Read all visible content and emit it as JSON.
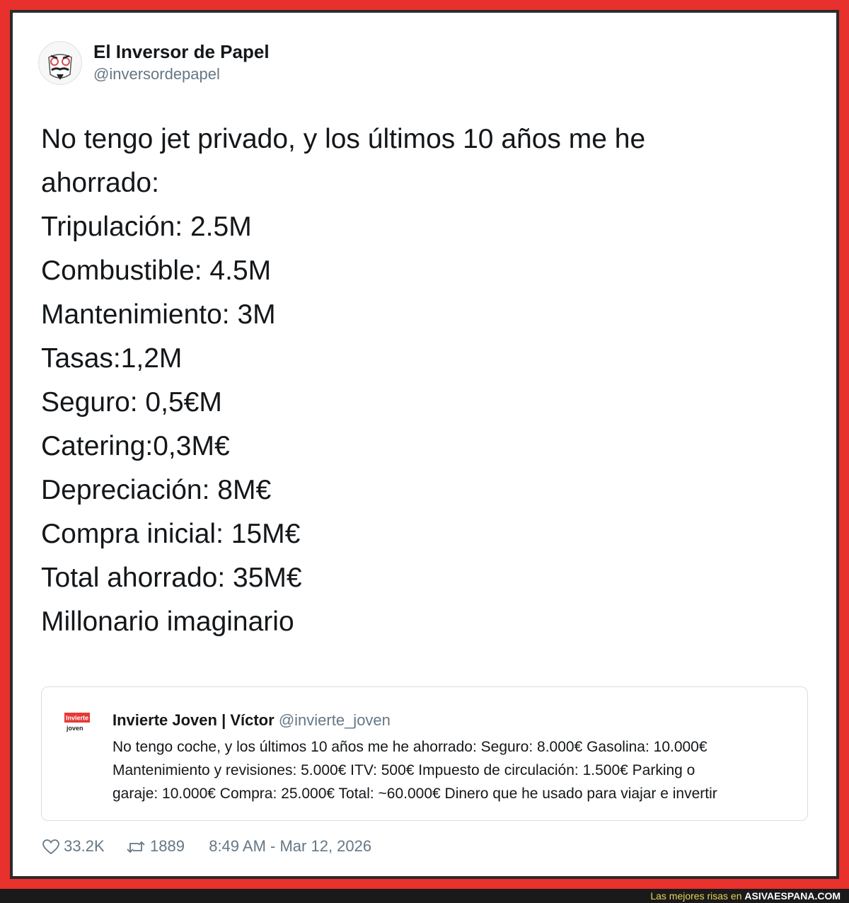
{
  "tweet": {
    "author": {
      "name": "El Inversor de Papel",
      "handle": "@inversordepapel",
      "avatar_icon": "money-heist-mask-icon"
    },
    "lines": [
      "No tengo jet privado, y los últimos 10 años me he",
      "ahorrado:",
      "Tripulación: 2.5M",
      "Combustible: 4.5M",
      "Mantenimiento: 3M",
      "Tasas:1,2M",
      "Seguro: 0,5€M",
      "Catering:0,3M€",
      "Depreciación: 8M€",
      "Compra inicial: 15M€",
      "Total ahorrado: 35M€",
      "Millonario imaginario"
    ],
    "quote": {
      "name": "Invierte Joven | Víctor",
      "handle": "@invierte_joven",
      "logo_line1": "Invierte",
      "logo_line2": "joven",
      "text_lines": [
        "No tengo coche, y los últimos 10 años me he ahorrado: Seguro: 8.000€ Gasolina: 10.000€",
        "Mantenimiento y revisiones: 5.000€ ITV: 500€ Impuesto de circulación: 1.500€ Parking o",
        "garaje: 10.000€ Compra: 25.000€ Total: ~60.000€ Dinero que he usado para viajar e invertir"
      ]
    },
    "footer": {
      "likes": "33.2K",
      "retweets": "1889",
      "timestamp": "8:49 AM - Mar 12, 2026"
    }
  },
  "watermark": {
    "text": "Las mejores risas en",
    "site": "ASIVAESPANA.COM"
  },
  "colors": {
    "frame": "#e8302c",
    "text": "#14171a",
    "secondary": "#657786",
    "watermark_text": "#e6d35a"
  }
}
